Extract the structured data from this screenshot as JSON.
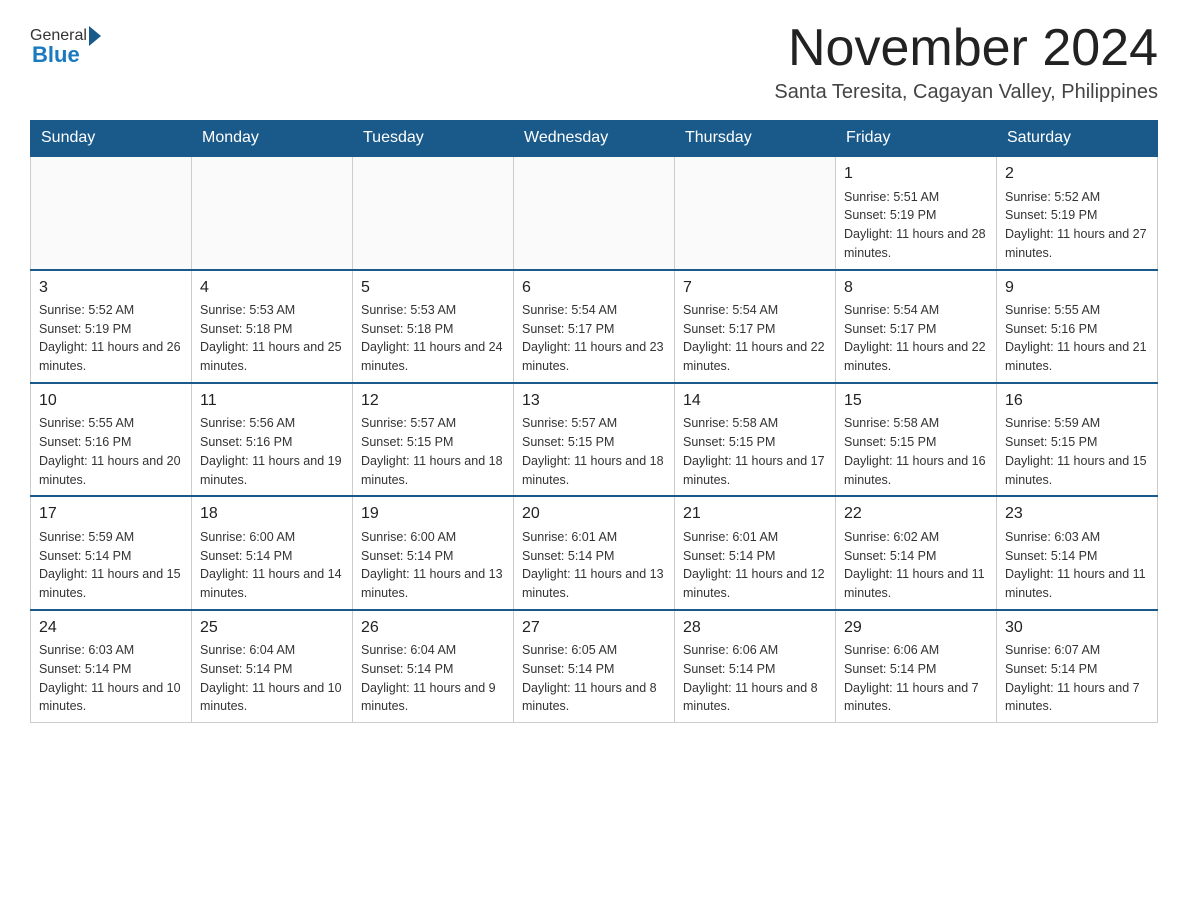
{
  "header": {
    "logo_general": "General",
    "logo_blue": "Blue",
    "month_title": "November 2024",
    "subtitle": "Santa Teresita, Cagayan Valley, Philippines"
  },
  "weekdays": [
    "Sunday",
    "Monday",
    "Tuesday",
    "Wednesday",
    "Thursday",
    "Friday",
    "Saturday"
  ],
  "weeks": [
    [
      {
        "day": "",
        "info": ""
      },
      {
        "day": "",
        "info": ""
      },
      {
        "day": "",
        "info": ""
      },
      {
        "day": "",
        "info": ""
      },
      {
        "day": "",
        "info": ""
      },
      {
        "day": "1",
        "info": "Sunrise: 5:51 AM\nSunset: 5:19 PM\nDaylight: 11 hours and 28 minutes."
      },
      {
        "day": "2",
        "info": "Sunrise: 5:52 AM\nSunset: 5:19 PM\nDaylight: 11 hours and 27 minutes."
      }
    ],
    [
      {
        "day": "3",
        "info": "Sunrise: 5:52 AM\nSunset: 5:19 PM\nDaylight: 11 hours and 26 minutes."
      },
      {
        "day": "4",
        "info": "Sunrise: 5:53 AM\nSunset: 5:18 PM\nDaylight: 11 hours and 25 minutes."
      },
      {
        "day": "5",
        "info": "Sunrise: 5:53 AM\nSunset: 5:18 PM\nDaylight: 11 hours and 24 minutes."
      },
      {
        "day": "6",
        "info": "Sunrise: 5:54 AM\nSunset: 5:17 PM\nDaylight: 11 hours and 23 minutes."
      },
      {
        "day": "7",
        "info": "Sunrise: 5:54 AM\nSunset: 5:17 PM\nDaylight: 11 hours and 22 minutes."
      },
      {
        "day": "8",
        "info": "Sunrise: 5:54 AM\nSunset: 5:17 PM\nDaylight: 11 hours and 22 minutes."
      },
      {
        "day": "9",
        "info": "Sunrise: 5:55 AM\nSunset: 5:16 PM\nDaylight: 11 hours and 21 minutes."
      }
    ],
    [
      {
        "day": "10",
        "info": "Sunrise: 5:55 AM\nSunset: 5:16 PM\nDaylight: 11 hours and 20 minutes."
      },
      {
        "day": "11",
        "info": "Sunrise: 5:56 AM\nSunset: 5:16 PM\nDaylight: 11 hours and 19 minutes."
      },
      {
        "day": "12",
        "info": "Sunrise: 5:57 AM\nSunset: 5:15 PM\nDaylight: 11 hours and 18 minutes."
      },
      {
        "day": "13",
        "info": "Sunrise: 5:57 AM\nSunset: 5:15 PM\nDaylight: 11 hours and 18 minutes."
      },
      {
        "day": "14",
        "info": "Sunrise: 5:58 AM\nSunset: 5:15 PM\nDaylight: 11 hours and 17 minutes."
      },
      {
        "day": "15",
        "info": "Sunrise: 5:58 AM\nSunset: 5:15 PM\nDaylight: 11 hours and 16 minutes."
      },
      {
        "day": "16",
        "info": "Sunrise: 5:59 AM\nSunset: 5:15 PM\nDaylight: 11 hours and 15 minutes."
      }
    ],
    [
      {
        "day": "17",
        "info": "Sunrise: 5:59 AM\nSunset: 5:14 PM\nDaylight: 11 hours and 15 minutes."
      },
      {
        "day": "18",
        "info": "Sunrise: 6:00 AM\nSunset: 5:14 PM\nDaylight: 11 hours and 14 minutes."
      },
      {
        "day": "19",
        "info": "Sunrise: 6:00 AM\nSunset: 5:14 PM\nDaylight: 11 hours and 13 minutes."
      },
      {
        "day": "20",
        "info": "Sunrise: 6:01 AM\nSunset: 5:14 PM\nDaylight: 11 hours and 13 minutes."
      },
      {
        "day": "21",
        "info": "Sunrise: 6:01 AM\nSunset: 5:14 PM\nDaylight: 11 hours and 12 minutes."
      },
      {
        "day": "22",
        "info": "Sunrise: 6:02 AM\nSunset: 5:14 PM\nDaylight: 11 hours and 11 minutes."
      },
      {
        "day": "23",
        "info": "Sunrise: 6:03 AM\nSunset: 5:14 PM\nDaylight: 11 hours and 11 minutes."
      }
    ],
    [
      {
        "day": "24",
        "info": "Sunrise: 6:03 AM\nSunset: 5:14 PM\nDaylight: 11 hours and 10 minutes."
      },
      {
        "day": "25",
        "info": "Sunrise: 6:04 AM\nSunset: 5:14 PM\nDaylight: 11 hours and 10 minutes."
      },
      {
        "day": "26",
        "info": "Sunrise: 6:04 AM\nSunset: 5:14 PM\nDaylight: 11 hours and 9 minutes."
      },
      {
        "day": "27",
        "info": "Sunrise: 6:05 AM\nSunset: 5:14 PM\nDaylight: 11 hours and 8 minutes."
      },
      {
        "day": "28",
        "info": "Sunrise: 6:06 AM\nSunset: 5:14 PM\nDaylight: 11 hours and 8 minutes."
      },
      {
        "day": "29",
        "info": "Sunrise: 6:06 AM\nSunset: 5:14 PM\nDaylight: 11 hours and 7 minutes."
      },
      {
        "day": "30",
        "info": "Sunrise: 6:07 AM\nSunset: 5:14 PM\nDaylight: 11 hours and 7 minutes."
      }
    ]
  ]
}
